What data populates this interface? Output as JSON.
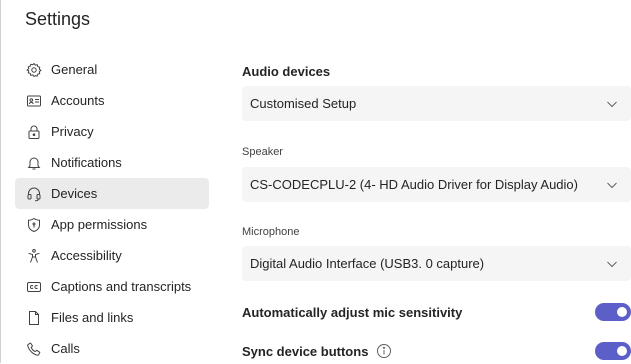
{
  "app": {
    "title": "Settings"
  },
  "sidebar": {
    "items": [
      {
        "label": "General",
        "icon": "gear-icon"
      },
      {
        "label": "Accounts",
        "icon": "id-card-icon"
      },
      {
        "label": "Privacy",
        "icon": "lock-icon"
      },
      {
        "label": "Notifications",
        "icon": "bell-icon"
      },
      {
        "label": "Devices",
        "icon": "headset-icon",
        "active": true
      },
      {
        "label": "App permissions",
        "icon": "shield-icon"
      },
      {
        "label": "Accessibility",
        "icon": "accessibility-icon"
      },
      {
        "label": "Captions and transcripts",
        "icon": "closed-captions-icon"
      },
      {
        "label": "Files and links",
        "icon": "document-icon"
      },
      {
        "label": "Calls",
        "icon": "phone-icon"
      }
    ]
  },
  "main": {
    "section_title": "Audio devices",
    "audio_setup": {
      "value": "Customised Setup"
    },
    "speaker": {
      "label": "Speaker",
      "value": "CS-CODECPLU-2 (4- HD Audio Driver for Display Audio)"
    },
    "microphone": {
      "label": "Microphone",
      "value": "Digital Audio Interface (USB3. 0 capture)"
    },
    "toggles": [
      {
        "label": "Automatically adjust mic sensitivity",
        "on": true
      },
      {
        "label": "Sync device buttons",
        "on": true,
        "info_icon": "info-icon"
      }
    ]
  },
  "colors": {
    "accent": "#5b5fc7",
    "active_bg": "#ebebeb",
    "select_bg": "#f5f5f5"
  }
}
